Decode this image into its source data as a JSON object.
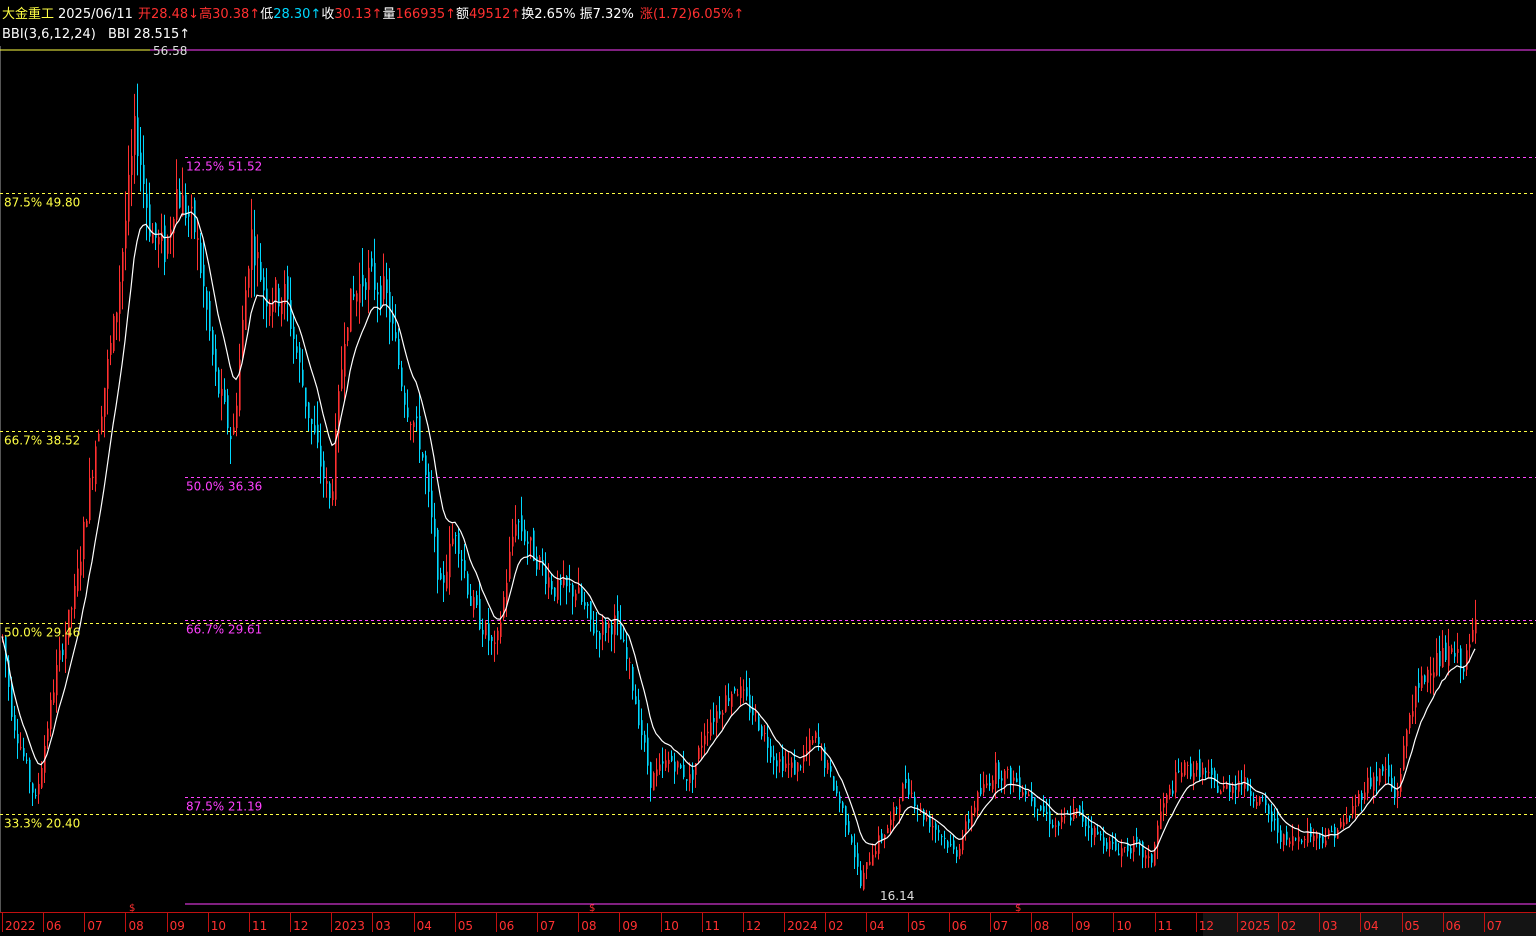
{
  "header": {
    "stock_name": "大金重工",
    "date": "2025/06/11",
    "open_label": "开",
    "open": "28.48↓",
    "high_label": "高",
    "high": "30.38↑",
    "low_label": "低",
    "low": "28.30↑",
    "close_label": "收",
    "close": "30.13↑",
    "volume_label": "量",
    "volume": "166935↑",
    "amount_label": "额",
    "amount": "49512↑",
    "turnover_label": "换",
    "turnover": "2.65%",
    "amplitude_label": "振",
    "amplitude": "7.32%",
    "change_label": "涨",
    "change": "(1.72)6.05%↑"
  },
  "indicator": {
    "name": "BBI(3,6,12,24)",
    "value_label": "BBI",
    "value": "28.515↑"
  },
  "colors": {
    "up": "#ff3030",
    "down": "#00d8ff",
    "bbi_line": "#ffffff",
    "fib_yellow": "#ffff44",
    "fib_magenta": "#ff40ff",
    "axis_text": "#ff3030",
    "axis_line": "#c01010"
  },
  "chart_data": {
    "type": "candlestick",
    "y_range": [
      16.14,
      56.58
    ],
    "max_label": "56.58",
    "min_label": "16.14",
    "fib_levels_yellow": [
      {
        "label": "87.5% 49.80",
        "value": 49.8
      },
      {
        "label": "66.7% 38.52",
        "value": 38.52
      },
      {
        "label": "50.0% 29.46",
        "value": 29.46
      },
      {
        "label": "33.3% 20.40",
        "value": 20.4
      }
    ],
    "fib_levels_magenta": [
      {
        "label": "12.5% 51.52",
        "value": 51.52
      },
      {
        "label": "50.0% 36.36",
        "value": 36.36
      },
      {
        "label": "66.7% 29.61",
        "value": 29.61
      },
      {
        "label": "87.5% 21.19",
        "value": 21.19
      }
    ],
    "x_axis_labels": [
      "2022",
      "06",
      "07",
      "08",
      "09",
      "10",
      "11",
      "12",
      "2023",
      "03",
      "04",
      "05",
      "06",
      "07",
      "08",
      "09",
      "10",
      "11",
      "12",
      "2024",
      "02",
      "04",
      "05",
      "06",
      "07",
      "08",
      "09",
      "10",
      "11",
      "12",
      "2025",
      "02",
      "03",
      "04",
      "05",
      "06",
      "07"
    ],
    "markers": [
      "$",
      "$",
      "$"
    ],
    "price_path": [
      [
        0,
        29.5
      ],
      [
        12,
        25
      ],
      [
        35,
        21
      ],
      [
        55,
        27
      ],
      [
        75,
        31
      ],
      [
        95,
        38
      ],
      [
        115,
        44
      ],
      [
        135,
        53
      ],
      [
        150,
        48
      ],
      [
        165,
        47
      ],
      [
        175,
        50
      ],
      [
        195,
        48
      ],
      [
        215,
        41
      ],
      [
        232,
        38
      ],
      [
        250,
        48
      ],
      [
        265,
        45
      ],
      [
        285,
        45
      ],
      [
        305,
        40
      ],
      [
        330,
        35
      ],
      [
        345,
        44
      ],
      [
        365,
        46
      ],
      [
        385,
        45
      ],
      [
        405,
        40
      ],
      [
        420,
        38
      ],
      [
        440,
        31
      ],
      [
        455,
        34
      ],
      [
        470,
        30.5
      ],
      [
        495,
        28
      ],
      [
        515,
        34.5
      ],
      [
        530,
        33
      ],
      [
        555,
        31
      ],
      [
        575,
        31
      ],
      [
        595,
        29
      ],
      [
        615,
        29.5
      ],
      [
        630,
        27
      ],
      [
        650,
        22
      ],
      [
        670,
        23
      ],
      [
        690,
        22
      ],
      [
        705,
        24.5
      ],
      [
        720,
        25.5
      ],
      [
        735,
        26.5
      ],
      [
        755,
        25
      ],
      [
        775,
        23
      ],
      [
        795,
        22.5
      ],
      [
        815,
        24
      ],
      [
        835,
        21.5
      ],
      [
        850,
        19.5
      ],
      [
        860,
        17
      ],
      [
        870,
        18.5
      ],
      [
        890,
        20
      ],
      [
        905,
        22
      ],
      [
        920,
        20.5
      ],
      [
        940,
        19.5
      ],
      [
        955,
        18.5
      ],
      [
        975,
        21
      ],
      [
        995,
        22.5
      ],
      [
        1015,
        22
      ],
      [
        1035,
        21
      ],
      [
        1055,
        19.8
      ],
      [
        1075,
        20.5
      ],
      [
        1095,
        19.5
      ],
      [
        1115,
        18.7
      ],
      [
        1135,
        18.9
      ],
      [
        1150,
        18
      ],
      [
        1160,
        20.5
      ],
      [
        1180,
        22.5
      ],
      [
        1200,
        22.5
      ],
      [
        1220,
        21.5
      ],
      [
        1240,
        22
      ],
      [
        1260,
        21
      ],
      [
        1285,
        19
      ],
      [
        1305,
        19.5
      ],
      [
        1325,
        19.3
      ],
      [
        1345,
        20
      ],
      [
        1365,
        21.8
      ],
      [
        1385,
        22.5
      ],
      [
        1395,
        21
      ],
      [
        1410,
        25.5
      ],
      [
        1430,
        27.5
      ],
      [
        1450,
        28
      ],
      [
        1465,
        27.5
      ],
      [
        1475,
        29.5
      ]
    ]
  }
}
